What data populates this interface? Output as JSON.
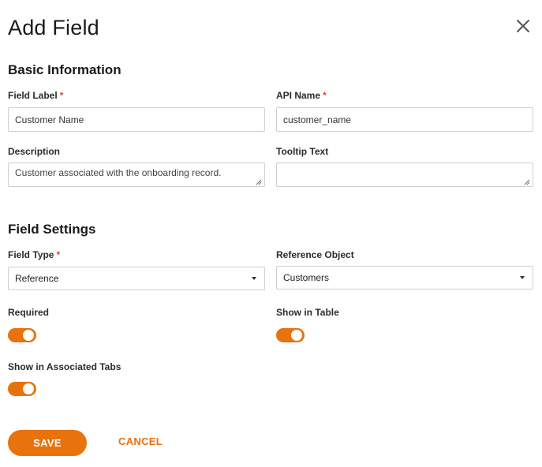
{
  "dialog": {
    "title": "Add Field",
    "close_icon": "close-icon"
  },
  "basic_info": {
    "heading": "Basic Information",
    "field_label": {
      "label": "Field Label",
      "required_mark": "*",
      "value": "Customer Name"
    },
    "api_name": {
      "label": "API Name",
      "required_mark": "*",
      "value": "customer_name"
    },
    "description": {
      "label": "Description",
      "value": "Customer associated with the onboarding record."
    },
    "tooltip_text": {
      "label": "Tooltip Text",
      "value": ""
    }
  },
  "field_settings": {
    "heading": "Field Settings",
    "field_type": {
      "label": "Field Type",
      "required_mark": "*",
      "selected": "Reference"
    },
    "reference_object": {
      "label": "Reference Object",
      "selected": "Customers"
    },
    "required": {
      "label": "Required",
      "on": true
    },
    "show_in_table": {
      "label": "Show in Table",
      "on": true
    },
    "show_in_associated_tabs": {
      "label": "Show in Associated Tabs",
      "on": true
    }
  },
  "actions": {
    "save_label": "SAVE",
    "cancel_label": "CANCEL"
  },
  "colors": {
    "accent": "#e8720c",
    "required_mark": "#e0442e"
  }
}
